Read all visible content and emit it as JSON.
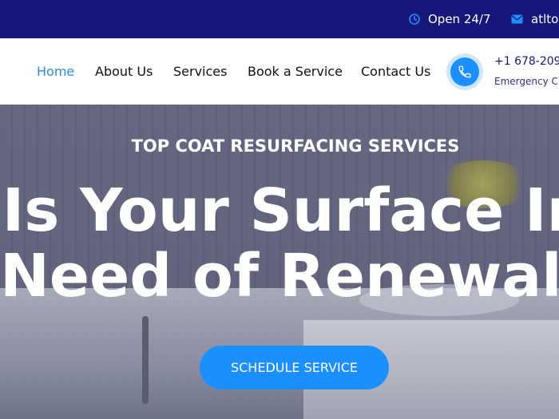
{
  "topbar": {
    "hours_text": "Open 24/7",
    "email_text": "atltop",
    "hours_icon": "clock-icon",
    "email_icon": "mail-icon"
  },
  "nav": {
    "items": [
      {
        "label": "Home",
        "active": true
      },
      {
        "label": "About Us",
        "active": false
      },
      {
        "label": "Services",
        "active": false
      },
      {
        "label": "Book a Service",
        "active": false
      },
      {
        "label": "Contact Us",
        "active": false
      }
    ],
    "phone_icon": "phone-icon",
    "phone_number": "+1 678-209",
    "phone_note": "Emergency C"
  },
  "hero": {
    "subtitle": "TOP COAT RESURFACING SERVICES",
    "headline_line1": "Is Your Surface In",
    "headline_line2": "Need of Renewal?",
    "cta_label": "SCHEDULE SERVICE"
  },
  "colors": {
    "topbar_bg": "#15177a",
    "accent": "#1c8fff",
    "active_link": "#2a8be0"
  }
}
